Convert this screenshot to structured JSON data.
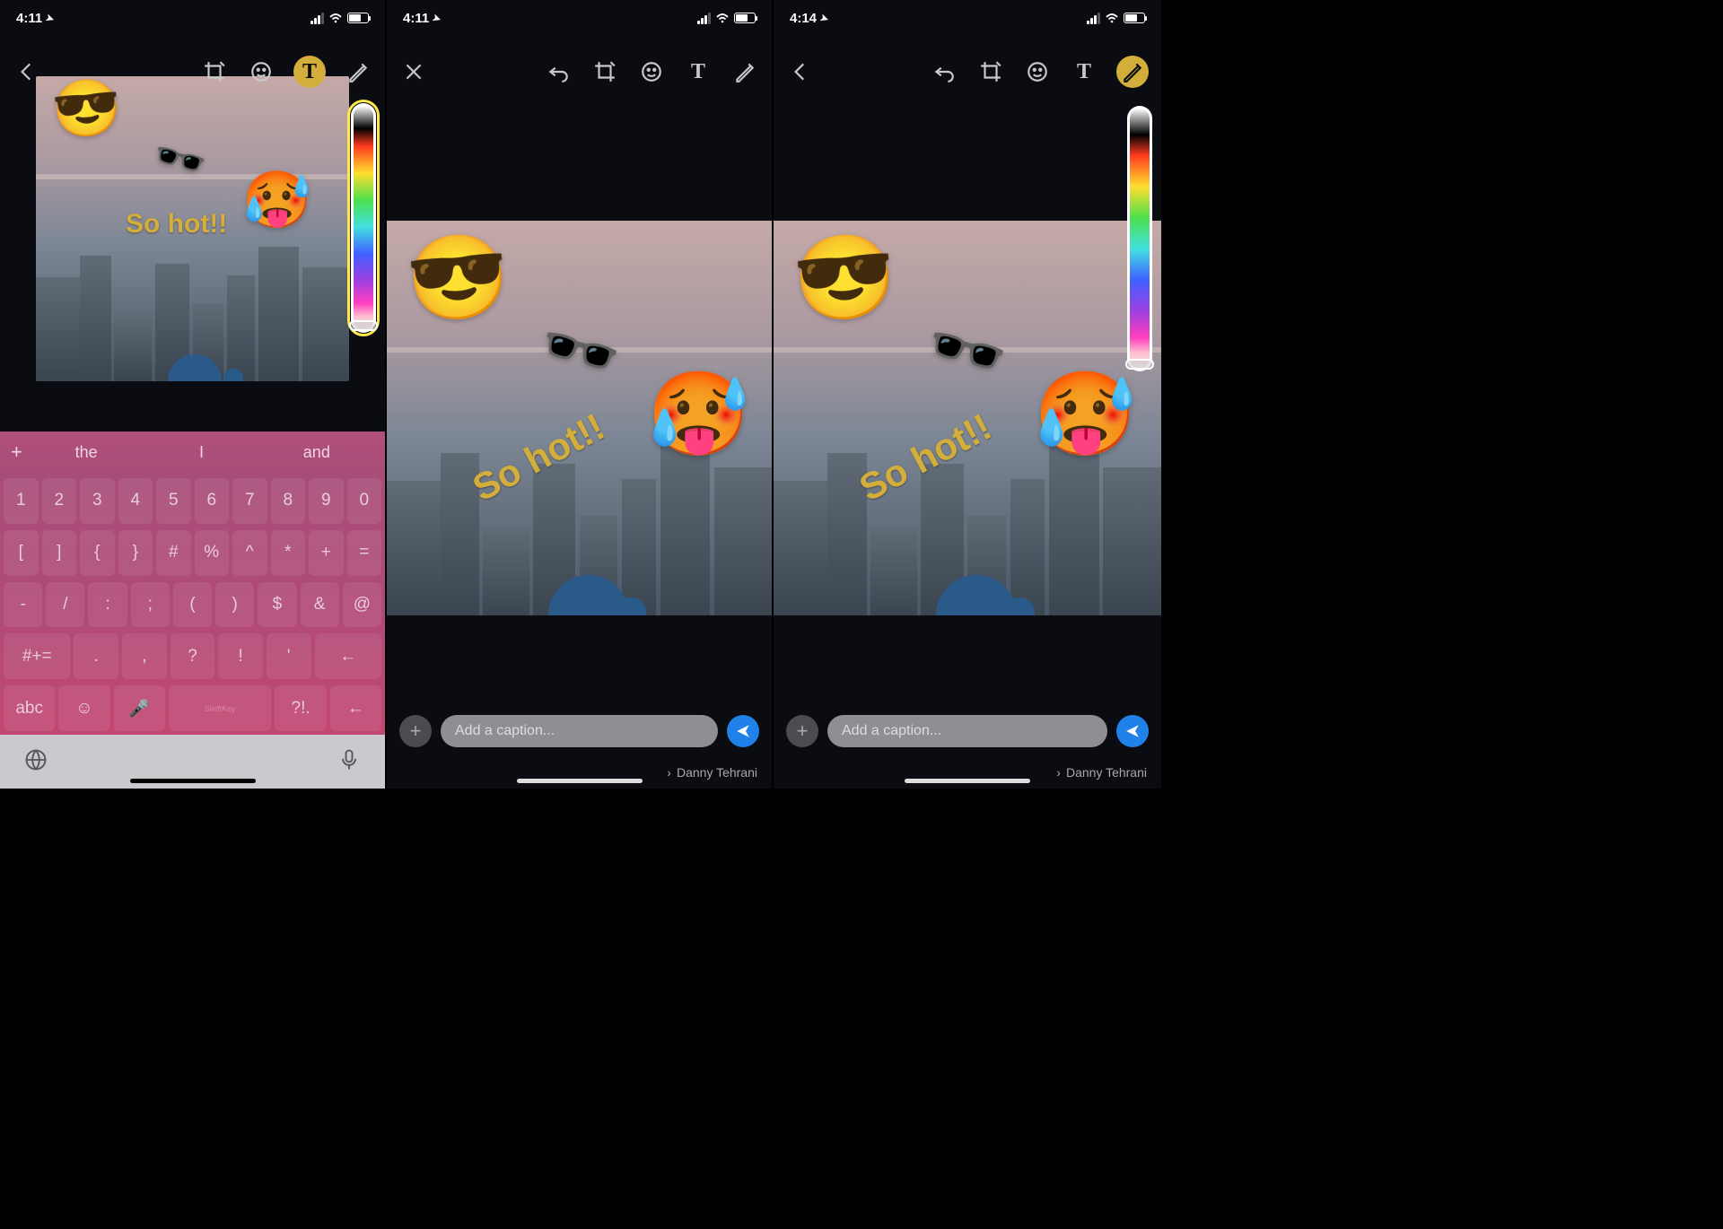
{
  "status": {
    "time1": "4:11",
    "time2": "4:11",
    "time3": "4:14"
  },
  "text_overlay": "So hot!!",
  "caption_placeholder": "Add a caption...",
  "recipient": "Danny Tehrani",
  "text_tool_glyph": "T",
  "emoji": {
    "cool": "😎",
    "glasses": "🕶️",
    "hot": "🥵"
  },
  "suggestions": {
    "plus": "+",
    "s1": "the",
    "s2": "I",
    "s3": "and"
  },
  "kbd_brand": "SwiftKey",
  "keys": {
    "r1": [
      "1",
      "2",
      "3",
      "4",
      "5",
      "6",
      "7",
      "8",
      "9",
      "0"
    ],
    "r2": [
      "[",
      "]",
      "{",
      "}",
      "#",
      "%",
      "^",
      "*",
      "+",
      "="
    ],
    "r3": [
      "-",
      "/",
      ":",
      ";",
      "(",
      ")",
      "$",
      "&",
      "@"
    ],
    "r4_left": "#+=",
    "r4_mid": [
      ".",
      ",",
      "?",
      "!",
      "'"
    ],
    "r4_back": "←",
    "r5_abc": "abc",
    "r5_back": "←"
  }
}
